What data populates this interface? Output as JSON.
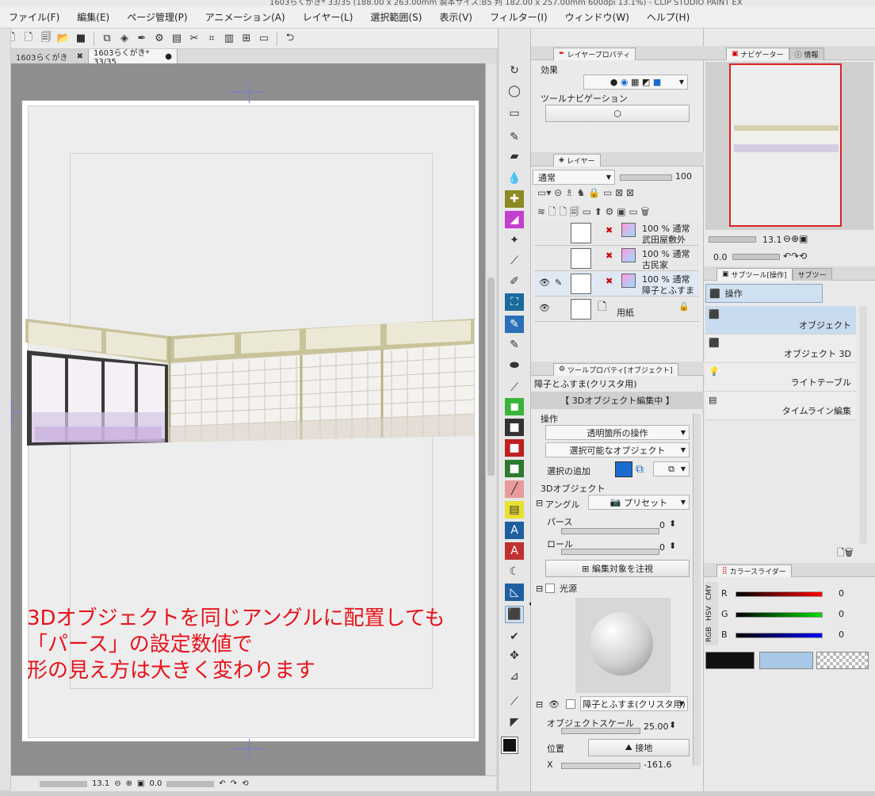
{
  "window": {
    "title": "1603らくがき* 33/35 (188.00 x 263.00mm 製本サイズ:B5 判 182.00 x 257.00mm 600dpi 13.1%) - CLIP STUDIO PAINT EX"
  },
  "menu": [
    "ファイル(F)",
    "編集(E)",
    "ページ管理(P)",
    "アニメーション(A)",
    "レイヤー(L)",
    "選択範囲(S)",
    "表示(V)",
    "フィルター(I)",
    "ウィンドウ(W)",
    "ヘルプ(H)"
  ],
  "tabs": {
    "tab1": "1603らくがき",
    "tab1_close": "✖",
    "tab2": "1603らくがき* 33/35",
    "tab2_dot": "●"
  },
  "overlay": {
    "line1": "3Dオブジェクトを同じアングルに配置しても",
    "line2": "「パース」の設定数値で",
    "line3": "形の見え方は大きく変わります"
  },
  "status": {
    "zoom": "13.1",
    "rotate": "0.0"
  },
  "layer_property": {
    "tab": "レイヤープロパティ",
    "effect_label": "効果",
    "toolnav_label": "ツールナビゲーション"
  },
  "layers_panel": {
    "tab": "レイヤー",
    "blend_mode": "通常",
    "opacity": "100",
    "layers": [
      {
        "pct": "100 %",
        "mode": "通常",
        "name": "武田屋敷外"
      },
      {
        "pct": "100 %",
        "mode": "通常",
        "name": "古民家"
      },
      {
        "pct": "100 %",
        "mode": "通常",
        "name": "障子とふすま"
      },
      {
        "name": "用紙"
      }
    ]
  },
  "tool_property": {
    "tab": "ツールプロパティ[オブジェクト]",
    "object_name": "障子とふすま(クリスタ用)",
    "edit_mode": "【 3Dオブジェクト編集中 】",
    "operation_label": "操作",
    "transparent_op": "透明箇所の操作",
    "selectable_obj": "選択可能なオブジェクト",
    "add_selection": "選択の追加",
    "obj3d_label": "3Dオブジェクト",
    "angle_label": "アングル",
    "preset": "プリセット",
    "perspective_label": "パース",
    "perspective_value": "0",
    "perspective_level": 0,
    "roll_label": "ロール",
    "roll_value": "0",
    "roll_level": 0,
    "focus_button": "編集対象を注視",
    "light_label": "光源",
    "object_dropdown": "障子とふすま(クリスタ用)",
    "scale_label": "オブジェクトスケール",
    "scale_value": "25.00",
    "position_label": "位置",
    "ground_button": "接地",
    "x_label": "X",
    "x_value": "-161.6"
  },
  "navigator": {
    "tab1": "ナビゲーター",
    "tab2": "情報",
    "zoom": "13.1",
    "rotate": "0.0"
  },
  "subtool": {
    "tab1": "サブツール[操作]",
    "tab2": "サブツー",
    "group": "操作",
    "items": [
      "オブジェクト",
      "オブジェクト 3D",
      "ライトテーブル",
      "タイムライン編集"
    ]
  },
  "color_slider": {
    "tab": "カラースライダー",
    "modes": [
      "RGB",
      "HSV",
      "CMY"
    ],
    "r_label": "R",
    "r_value": "0",
    "r_level": 0,
    "g_label": "G",
    "g_value": "0",
    "g_level": 0,
    "b_label": "B",
    "b_value": "0",
    "b_level": 0
  },
  "colors": {
    "main": "#111111",
    "sub": "#a9c8e8",
    "accent": "#1a6ad0",
    "overlay_text": "#e8121b"
  }
}
